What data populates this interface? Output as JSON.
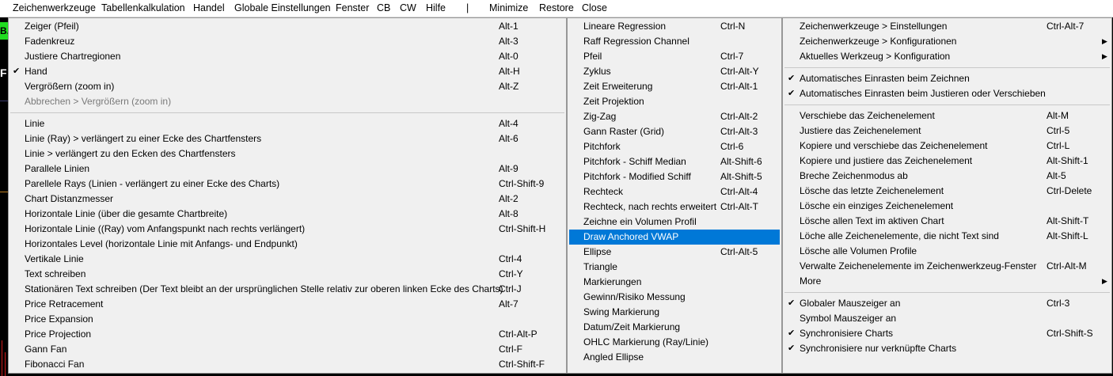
{
  "menubar": {
    "items": [
      "Zeichenwerkzeuge",
      "Tabellenkalkulation",
      "Handel",
      "Globale Einstellungen",
      "Fenster",
      "CB",
      "CW",
      "Hilfe",
      "|",
      "Minimize",
      "Restore",
      "Close"
    ]
  },
  "chart": {
    "tag_green": "B.",
    "tag_f": "F"
  },
  "colors": {
    "highlight": "#0078d7",
    "menu_bg": "#f0f0f0",
    "chart_bg": "#000000",
    "tag_green": "#1fdd1f",
    "spike": "#d01c1c"
  },
  "menu_left": {
    "items": [
      {
        "label": "Zeiger (Pfeil)",
        "shortcut": "Alt-1"
      },
      {
        "label": "Fadenkreuz",
        "shortcut": "Alt-3"
      },
      {
        "label": "Justiere Chartregionen",
        "shortcut": "Alt-0"
      },
      {
        "label": "Hand",
        "shortcut": "Alt-H",
        "check": "✔"
      },
      {
        "label": "Vergrößern (zoom in)",
        "shortcut": "Alt-Z"
      },
      {
        "label": "Abbrechen > Vergrößern (zoom in)",
        "shortcut": ""
      },
      {
        "label": "Linie",
        "shortcut": "Alt-4"
      },
      {
        "label": "Linie (Ray) > verlängert zu einer Ecke des Chartfensters",
        "shortcut": "Alt-6"
      },
      {
        "label": "Linie > verlängert zu den Ecken des Chartfensters",
        "shortcut": ""
      },
      {
        "label": "Parallele Linien",
        "shortcut": "Alt-9"
      },
      {
        "label": "Parellele Rays (Linien - verlängert zu einer Ecke des Charts)",
        "shortcut": "Ctrl-Shift-9"
      },
      {
        "label": "Chart Distanzmesser",
        "shortcut": "Alt-2"
      },
      {
        "label": "Horizontale Linie (über die gesamte Chartbreite)",
        "shortcut": "Alt-8"
      },
      {
        "label": "Horizontale Linie ((Ray) vom Anfangspunkt nach rechts verlängert)",
        "shortcut": "Ctrl-Shift-H"
      },
      {
        "label": "Horizontales Level (horizontale Linie mit Anfangs- und Endpunkt)",
        "shortcut": ""
      },
      {
        "label": "Vertikale Linie",
        "shortcut": "Ctrl-4"
      },
      {
        "label": "Text schreiben",
        "shortcut": "Ctrl-Y"
      },
      {
        "label": "Stationären Text schreiben (Der Text bleibt an der ursprünglichen Stelle relativ zur oberen linken Ecke des Charts)",
        "shortcut": "Ctrl-J"
      },
      {
        "label": "Price Retracement",
        "shortcut": "Alt-7"
      },
      {
        "label": "Price Expansion",
        "shortcut": ""
      },
      {
        "label": "Price Projection",
        "shortcut": "Ctrl-Alt-P"
      },
      {
        "label": "Gann Fan",
        "shortcut": "Ctrl-F"
      },
      {
        "label": "Fibonacci Fan",
        "shortcut": "Ctrl-Shift-F"
      }
    ]
  },
  "menu_mid": {
    "items": [
      {
        "label": "Lineare Regression",
        "shortcut": "Ctrl-N"
      },
      {
        "label": "Raff Regression Channel",
        "shortcut": ""
      },
      {
        "label": "Pfeil",
        "shortcut": "Ctrl-7"
      },
      {
        "label": "Zyklus",
        "shortcut": "Ctrl-Alt-Y"
      },
      {
        "label": "Zeit Erweiterung",
        "shortcut": "Ctrl-Alt-1"
      },
      {
        "label": "Zeit Projektion",
        "shortcut": ""
      },
      {
        "label": "Zig-Zag",
        "shortcut": "Ctrl-Alt-2"
      },
      {
        "label": "Gann Raster (Grid)",
        "shortcut": "Ctrl-Alt-3"
      },
      {
        "label": "Pitchfork",
        "shortcut": "Ctrl-6"
      },
      {
        "label": "Pitchfork - Schiff Median",
        "shortcut": "Alt-Shift-6"
      },
      {
        "label": "Pitchfork - Modified Schiff",
        "shortcut": "Alt-Shift-5"
      },
      {
        "label": "Rechteck",
        "shortcut": "Ctrl-Alt-4"
      },
      {
        "label": "Rechteck, nach rechts erweitert",
        "shortcut": "Ctrl-Alt-T"
      },
      {
        "label": "Zeichne ein Volumen Profil",
        "shortcut": ""
      },
      {
        "label": "Draw Anchored VWAP",
        "shortcut": ""
      },
      {
        "label": "Ellipse",
        "shortcut": "Ctrl-Alt-5"
      },
      {
        "label": "Triangle",
        "shortcut": ""
      },
      {
        "label": "Markierungen",
        "shortcut": ""
      },
      {
        "label": "Gewinn/Risiko Messung",
        "shortcut": ""
      },
      {
        "label": "Swing Markierung",
        "shortcut": ""
      },
      {
        "label": "Datum/Zeit Markierung",
        "shortcut": ""
      },
      {
        "label": "OHLC Markierung (Ray/Linie)",
        "shortcut": ""
      },
      {
        "label": "Angled Ellipse",
        "shortcut": ""
      }
    ]
  },
  "menu_right": {
    "items": [
      {
        "label": "Zeichenwerkzeuge > Einstellungen",
        "shortcut": "Ctrl-Alt-7"
      },
      {
        "label": "Zeichenwerkzeuge > Konfigurationen",
        "shortcut": "",
        "arrow": "▶"
      },
      {
        "label": "Aktuelles Werkzeug > Konfiguration",
        "shortcut": "",
        "arrow": "▶"
      },
      {
        "label": "Automatisches Einrasten beim Zeichnen",
        "shortcut": "",
        "check": "✔"
      },
      {
        "label": "Automatisches Einrasten beim Justieren oder Verschieben",
        "shortcut": "",
        "check": "✔"
      },
      {
        "label": "Verschiebe das Zeichenelement",
        "shortcut": "Alt-M"
      },
      {
        "label": "Justiere das Zeichenelement",
        "shortcut": "Ctrl-5"
      },
      {
        "label": "Kopiere und verschiebe das Zeichenelement",
        "shortcut": "Ctrl-L"
      },
      {
        "label": "Kopiere und justiere das Zeichenelement",
        "shortcut": "Alt-Shift-1"
      },
      {
        "label": "Breche Zeichenmodus ab",
        "shortcut": "Alt-5"
      },
      {
        "label": "Lösche das letzte Zeichenelement",
        "shortcut": "Ctrl-Delete"
      },
      {
        "label": "Lösche ein einziges Zeichenelement",
        "shortcut": ""
      },
      {
        "label": "Lösche allen Text im aktiven Chart",
        "shortcut": "Alt-Shift-T"
      },
      {
        "label": "Löche alle Zeichenelemente, die nicht Text sind",
        "shortcut": "Alt-Shift-L"
      },
      {
        "label": "Lösche alle Volumen Profile",
        "shortcut": ""
      },
      {
        "label": "Verwalte Zeichenelemente im Zeichenwerkzeug-Fenster",
        "shortcut": "Ctrl-Alt-M"
      },
      {
        "label": "More",
        "shortcut": "",
        "arrow": "▶"
      },
      {
        "label": "Globaler Mauszeiger an",
        "shortcut": "Ctrl-3",
        "check": "✔"
      },
      {
        "label": "Symbol Mauszeiger an",
        "shortcut": ""
      },
      {
        "label": "Synchronisiere Charts",
        "shortcut": "Ctrl-Shift-S",
        "check": "✔"
      },
      {
        "label": "Synchronisiere nur verknüpfte Charts",
        "shortcut": "",
        "check": "✔"
      }
    ]
  }
}
